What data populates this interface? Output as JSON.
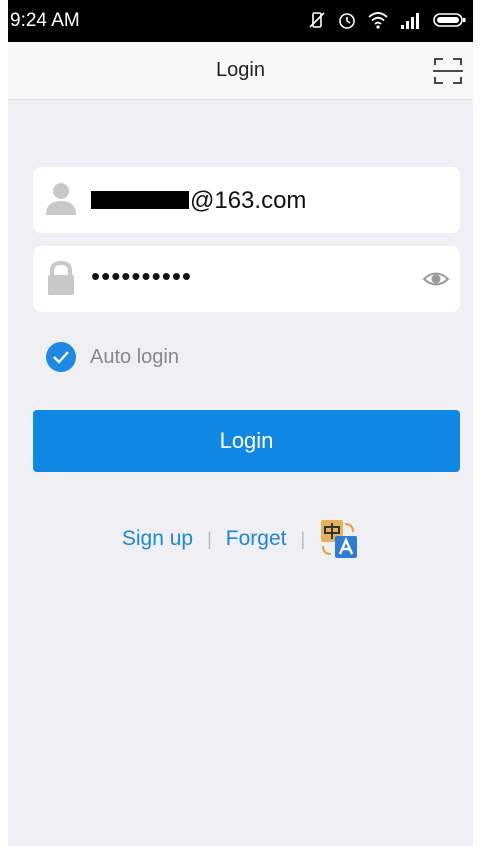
{
  "status_bar": {
    "time": "9:24 AM",
    "icons": [
      "vibrate-off-icon",
      "alarm-icon",
      "wifi-icon",
      "signal-icon",
      "battery-icon"
    ]
  },
  "navbar": {
    "title": "Login",
    "scan_icon": "scan-icon"
  },
  "form": {
    "username": {
      "icon": "user-icon",
      "value_suffix": "@163.com"
    },
    "password": {
      "icon": "lock-icon",
      "masked_value": "••••••••••",
      "toggle_icon": "eye-icon"
    },
    "auto_login": {
      "label": "Auto login",
      "checked": true
    },
    "login_button": "Login"
  },
  "links": {
    "sign_up": "Sign up",
    "separator": "|",
    "forget": "Forget",
    "language_icon": "language-switch-icon"
  },
  "colors": {
    "accent": "#1088e3",
    "link": "#1a88d8",
    "background": "#efeff4"
  }
}
